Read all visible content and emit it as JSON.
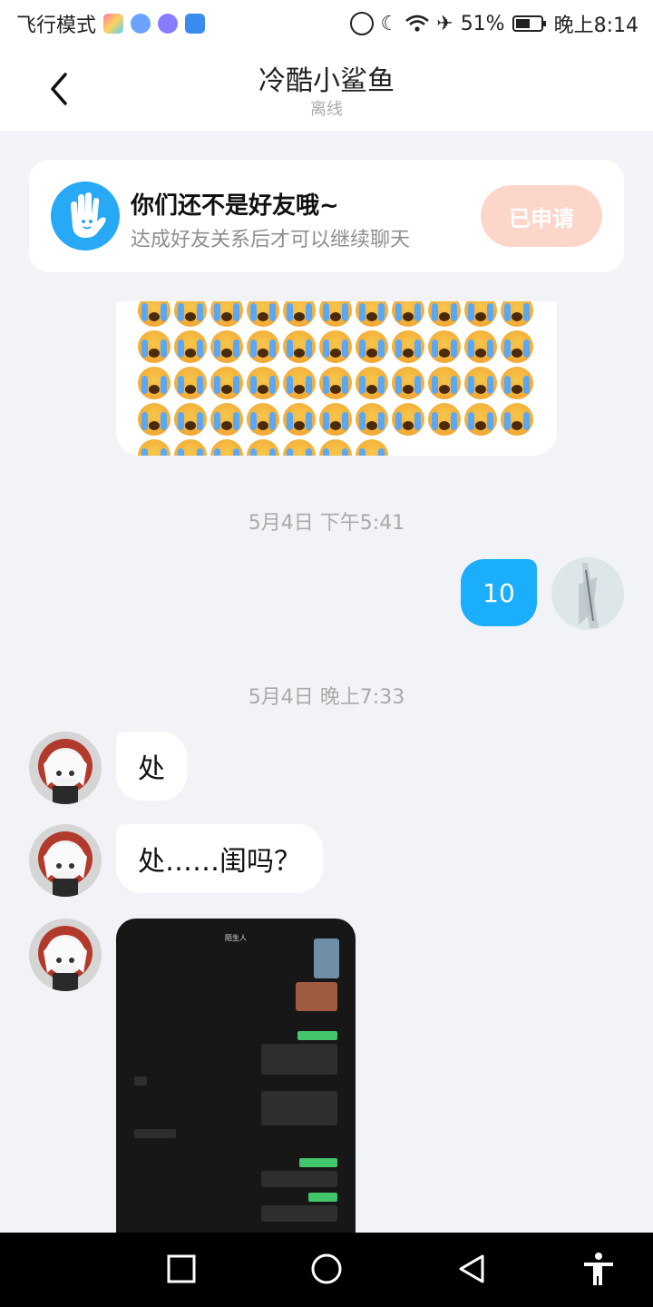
{
  "status_bar": {
    "left_text": "飞行模式",
    "battery_percent": "51%",
    "time": "晚上8:14"
  },
  "header": {
    "title": "冷酷小鲨鱼",
    "subtitle": "离线"
  },
  "friend_notice": {
    "title": "你们还不是好友哦~",
    "description": "达成好友关系后才可以继续聊天",
    "button_label": "已申请"
  },
  "messages": {
    "timestamp_1": "5月4日 下午5:41",
    "my_message": "10",
    "timestamp_2": "5月4日 晚上7:33",
    "their_message_1": "处",
    "their_message_2": "处……闺吗？"
  },
  "shared_screenshot": {
    "header_text": "陌生人"
  },
  "colors": {
    "accent_blue": "#1aaefd",
    "button_peach": "#fcd6c9",
    "background": "#f2f3f6"
  },
  "icons": {
    "back": "chevron-left-icon",
    "hand": "hand-wave-icon",
    "nav_recent": "square-icon",
    "nav_home": "circle-icon",
    "nav_back": "triangle-back-icon",
    "nav_accessibility": "accessibility-icon"
  }
}
